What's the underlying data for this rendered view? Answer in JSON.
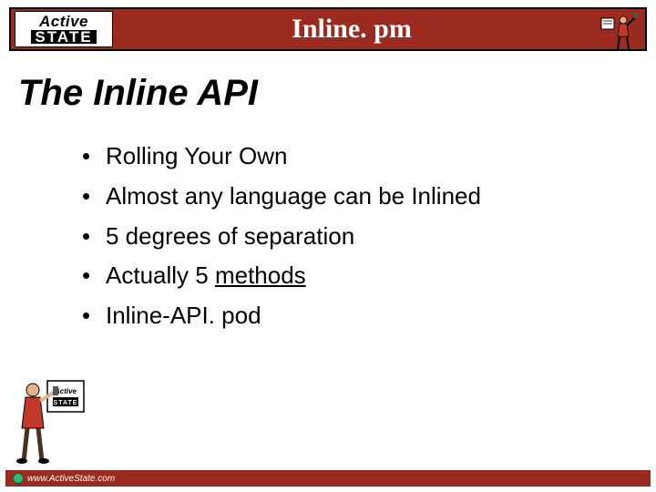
{
  "header": {
    "logo_top": "Active",
    "logo_bottom": "STATE",
    "title": "Inline. pm"
  },
  "slide": {
    "title": "The Inline API"
  },
  "bullets": {
    "items": [
      "Rolling Your Own",
      "Almost any language can be Inlined",
      "5 degrees of separation",
      "Actually 5 ",
      "Inline-API. pod"
    ],
    "item3_underlined": "methods"
  },
  "footer": {
    "url": "www.ActiveState.com"
  }
}
